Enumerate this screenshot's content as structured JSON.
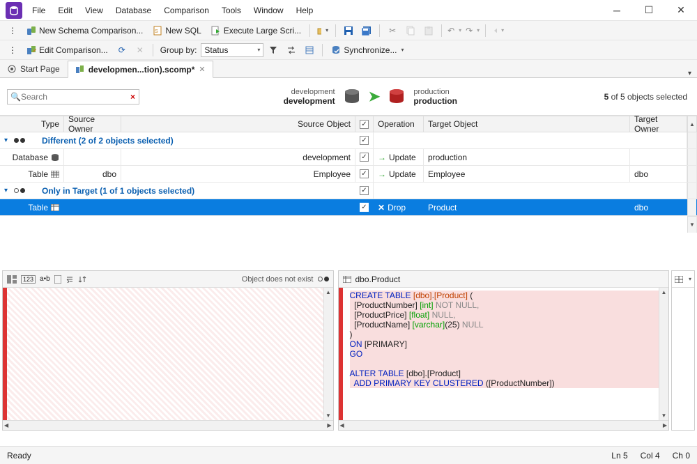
{
  "menu": [
    "File",
    "Edit",
    "View",
    "Database",
    "Comparison",
    "Tools",
    "Window",
    "Help"
  ],
  "toolbar1": {
    "newSchema": "New Schema Comparison...",
    "newSql": "New SQL",
    "execLarge": "Execute Large Scri..."
  },
  "toolbar2": {
    "editComp": "Edit Comparison...",
    "groupByLabel": "Group by:",
    "groupByValue": "Status",
    "sync": "Synchronize..."
  },
  "tabs": {
    "start": "Start Page",
    "active": "developmen...tion).scomp*"
  },
  "search": {
    "placeholder": "Search"
  },
  "srctgt": {
    "srcTop": "development",
    "srcBottom": "development",
    "tgtTop": "production",
    "tgtBottom": "production"
  },
  "selcount": {
    "bold": "5",
    "rest": " of 5 objects selected"
  },
  "cols": {
    "type": "Type",
    "srcOwner": "Source Owner",
    "srcObj": "Source Object",
    "op": "Operation",
    "tgtObj": "Target Object",
    "tgtOwner": "Target Owner"
  },
  "groups": {
    "diff": "Different (2 of 2 objects selected)",
    "only": "Only in Target (1 of 1 objects selected)"
  },
  "rows": {
    "r1": {
      "type": "Database",
      "srcObj": "development",
      "op": "Update",
      "tgtObj": "production"
    },
    "r2": {
      "type": "Table",
      "srcOwn": "dbo",
      "srcObj": "Employee",
      "op": "Update",
      "tgtObj": "Employee",
      "tgtOwn": "dbo"
    },
    "r3": {
      "type": "Table",
      "op": "Drop",
      "tgtObj": "Product",
      "tgtOwn": "dbo"
    }
  },
  "diff": {
    "leftStatus": "Object does not exist",
    "rightTitle": "dbo.Product"
  },
  "code": {
    "l1a": "CREATE TABLE",
    "l1b": "[dbo]",
    "l1c": "[Product]",
    "l1d": " (",
    "l2a": "  [ProductNumber] ",
    "l2b": "[int]",
    "l2c": " NOT NULL,",
    "l3a": "  [ProductPrice] ",
    "l3b": "[float]",
    "l3c": " NULL,",
    "l4a": "  [ProductName] ",
    "l4b": "[varchar]",
    "l4c": "(25)",
    "l4d": " NULL",
    "l5": ")",
    "l6a": "ON",
    "l6b": " [PRIMARY]",
    "l7": "GO",
    "l8": "",
    "l9a": "ALTER TABLE",
    "l9b": " [dbo].[Product]",
    "l10a": "  ADD",
    "l10b": " PRIMARY KEY CLUSTERED",
    "l10c": " ([ProductNumber])"
  },
  "status": {
    "ready": "Ready",
    "ln": "Ln 5",
    "col": "Col 4",
    "ch": "Ch 0"
  }
}
